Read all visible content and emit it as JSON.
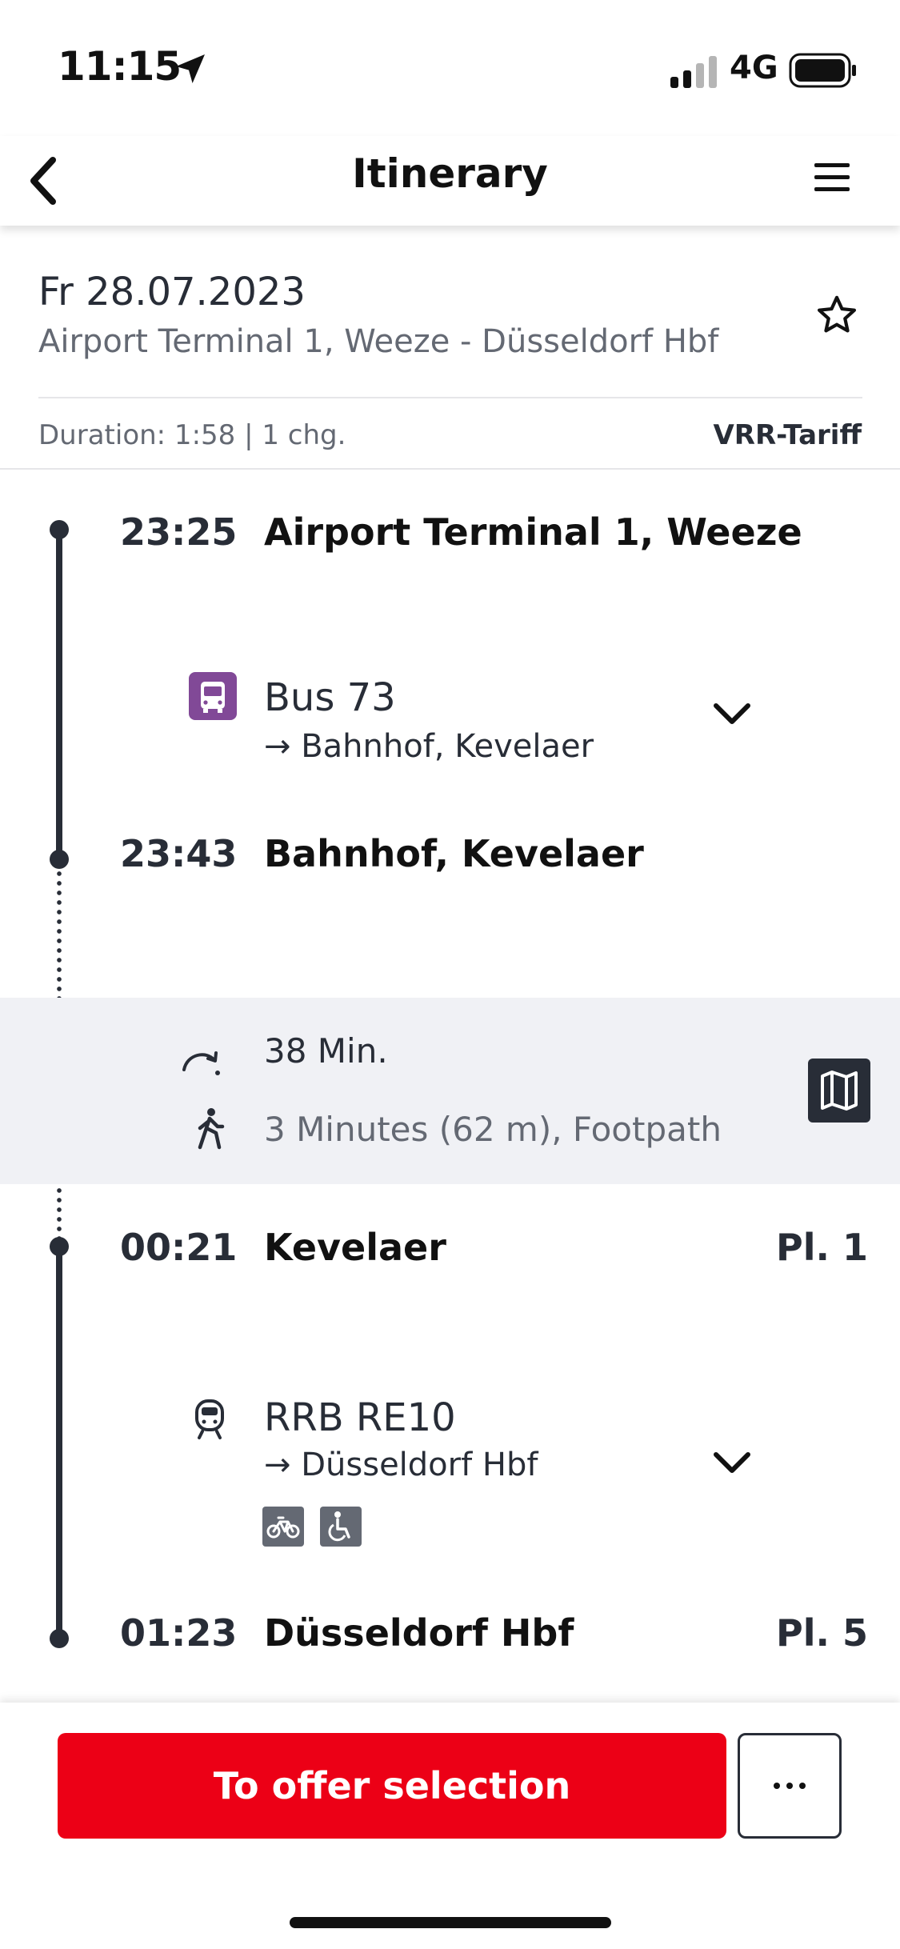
{
  "status_bar": {
    "time": "11:15",
    "network": "4G",
    "icons": [
      "location-arrow-icon",
      "signal-icon",
      "battery-icon"
    ]
  },
  "nav": {
    "title": "Itinerary",
    "back_icon": "chevron-left-icon",
    "menu_icon": "hamburger-menu-icon"
  },
  "summary": {
    "date": "Fr 28.07.2023",
    "route": "Airport Terminal 1, Weeze - Düsseldorf Hbf",
    "duration": "Duration: 1:58 | 1 chg.",
    "tariff": "VRR-Tariff",
    "favorite_icon": "star-outline-icon"
  },
  "stops": [
    {
      "time": "23:25",
      "name": "Airport Terminal 1, Weeze",
      "platform": ""
    },
    {
      "time": "23:43",
      "name": "Bahnhof, Kevelaer",
      "platform": ""
    },
    {
      "time": "00:21",
      "name": "Kevelaer",
      "platform": "Pl. 1"
    },
    {
      "time": "01:23",
      "name": "Düsseldorf Hbf",
      "platform": "Pl. 5"
    }
  ],
  "legs": [
    {
      "mode_icon": "bus-icon",
      "name": "Bus 73",
      "direction": "→ Bahnhof, Kevelaer",
      "amenities": []
    },
    {
      "mode_icon": "regional-train-icon",
      "name": "RRB RE10",
      "direction": "→ Düsseldorf Hbf",
      "amenities": [
        "bicycle-icon",
        "wheelchair-icon"
      ]
    }
  ],
  "transfer": {
    "wait": "38 Min.",
    "walk": "3 Minutes (62 m), Footpath",
    "map_icon": "map-icon"
  },
  "footer": {
    "primary_button": "To offer selection",
    "more_button": "more-options-icon"
  },
  "colors": {
    "primary_red": "#ec0016",
    "timeline": "#282d37",
    "bus_purple": "#814997",
    "transfer_bg": "#f0f1f5"
  }
}
